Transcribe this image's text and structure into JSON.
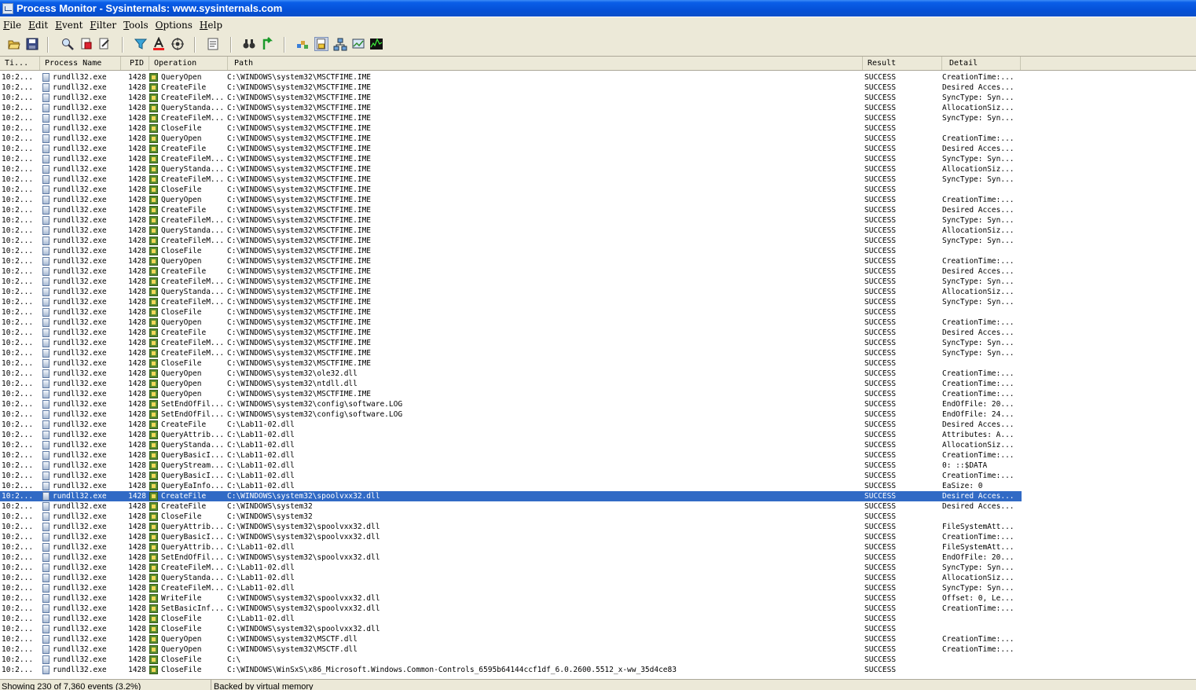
{
  "window": {
    "title": "Process Monitor - Sysinternals: www.sysinternals.com"
  },
  "menu": [
    "File",
    "Edit",
    "Event",
    "Filter",
    "Tools",
    "Options",
    "Help"
  ],
  "toolbar": [
    "open-icon",
    "save-icon",
    "magnify-icon",
    "capture-icon",
    "clear-icon",
    "filter-icon",
    "highlight-icon",
    "target-icon",
    "properties-icon",
    "find-icon",
    "jump-icon",
    "registry-icon",
    "filesystem-icon",
    "network-icon",
    "process-icon",
    "profiling-icon"
  ],
  "columns": {
    "time": "Ti...",
    "process": "Process Name",
    "pid": "PID",
    "operation": "Operation",
    "path": "Path",
    "result": "Result",
    "detail": "Detail"
  },
  "rows": [
    [
      "10:2...",
      "rundll32.exe",
      "1428",
      "QueryOpen",
      "C:\\WINDOWS\\system32\\MSCTFIME.IME",
      "SUCCESS",
      "CreationTime:..."
    ],
    [
      "10:2...",
      "rundll32.exe",
      "1428",
      "CreateFile",
      "C:\\WINDOWS\\system32\\MSCTFIME.IME",
      "SUCCESS",
      "Desired Acces..."
    ],
    [
      "10:2...",
      "rundll32.exe",
      "1428",
      "CreateFileM...",
      "C:\\WINDOWS\\system32\\MSCTFIME.IME",
      "SUCCESS",
      "SyncType: Syn..."
    ],
    [
      "10:2...",
      "rundll32.exe",
      "1428",
      "QueryStanda...",
      "C:\\WINDOWS\\system32\\MSCTFIME.IME",
      "SUCCESS",
      "AllocationSiz..."
    ],
    [
      "10:2...",
      "rundll32.exe",
      "1428",
      "CreateFileM...",
      "C:\\WINDOWS\\system32\\MSCTFIME.IME",
      "SUCCESS",
      "SyncType: Syn..."
    ],
    [
      "10:2...",
      "rundll32.exe",
      "1428",
      "CloseFile",
      "C:\\WINDOWS\\system32\\MSCTFIME.IME",
      "SUCCESS",
      ""
    ],
    [
      "10:2...",
      "rundll32.exe",
      "1428",
      "QueryOpen",
      "C:\\WINDOWS\\system32\\MSCTFIME.IME",
      "SUCCESS",
      "CreationTime:..."
    ],
    [
      "10:2...",
      "rundll32.exe",
      "1428",
      "CreateFile",
      "C:\\WINDOWS\\system32\\MSCTFIME.IME",
      "SUCCESS",
      "Desired Acces..."
    ],
    [
      "10:2...",
      "rundll32.exe",
      "1428",
      "CreateFileM...",
      "C:\\WINDOWS\\system32\\MSCTFIME.IME",
      "SUCCESS",
      "SyncType: Syn..."
    ],
    [
      "10:2...",
      "rundll32.exe",
      "1428",
      "QueryStanda...",
      "C:\\WINDOWS\\system32\\MSCTFIME.IME",
      "SUCCESS",
      "AllocationSiz..."
    ],
    [
      "10:2...",
      "rundll32.exe",
      "1428",
      "CreateFileM...",
      "C:\\WINDOWS\\system32\\MSCTFIME.IME",
      "SUCCESS",
      "SyncType: Syn..."
    ],
    [
      "10:2...",
      "rundll32.exe",
      "1428",
      "CloseFile",
      "C:\\WINDOWS\\system32\\MSCTFIME.IME",
      "SUCCESS",
      ""
    ],
    [
      "10:2...",
      "rundll32.exe",
      "1428",
      "QueryOpen",
      "C:\\WINDOWS\\system32\\MSCTFIME.IME",
      "SUCCESS",
      "CreationTime:..."
    ],
    [
      "10:2...",
      "rundll32.exe",
      "1428",
      "CreateFile",
      "C:\\WINDOWS\\system32\\MSCTFIME.IME",
      "SUCCESS",
      "Desired Acces..."
    ],
    [
      "10:2...",
      "rundll32.exe",
      "1428",
      "CreateFileM...",
      "C:\\WINDOWS\\system32\\MSCTFIME.IME",
      "SUCCESS",
      "SyncType: Syn..."
    ],
    [
      "10:2...",
      "rundll32.exe",
      "1428",
      "QueryStanda...",
      "C:\\WINDOWS\\system32\\MSCTFIME.IME",
      "SUCCESS",
      "AllocationSiz..."
    ],
    [
      "10:2...",
      "rundll32.exe",
      "1428",
      "CreateFileM...",
      "C:\\WINDOWS\\system32\\MSCTFIME.IME",
      "SUCCESS",
      "SyncType: Syn..."
    ],
    [
      "10:2...",
      "rundll32.exe",
      "1428",
      "CloseFile",
      "C:\\WINDOWS\\system32\\MSCTFIME.IME",
      "SUCCESS",
      ""
    ],
    [
      "10:2...",
      "rundll32.exe",
      "1428",
      "QueryOpen",
      "C:\\WINDOWS\\system32\\MSCTFIME.IME",
      "SUCCESS",
      "CreationTime:..."
    ],
    [
      "10:2...",
      "rundll32.exe",
      "1428",
      "CreateFile",
      "C:\\WINDOWS\\system32\\MSCTFIME.IME",
      "SUCCESS",
      "Desired Acces..."
    ],
    [
      "10:2...",
      "rundll32.exe",
      "1428",
      "CreateFileM...",
      "C:\\WINDOWS\\system32\\MSCTFIME.IME",
      "SUCCESS",
      "SyncType: Syn..."
    ],
    [
      "10:2...",
      "rundll32.exe",
      "1428",
      "QueryStanda...",
      "C:\\WINDOWS\\system32\\MSCTFIME.IME",
      "SUCCESS",
      "AllocationSiz..."
    ],
    [
      "10:2...",
      "rundll32.exe",
      "1428",
      "CreateFileM...",
      "C:\\WINDOWS\\system32\\MSCTFIME.IME",
      "SUCCESS",
      "SyncType: Syn..."
    ],
    [
      "10:2...",
      "rundll32.exe",
      "1428",
      "CloseFile",
      "C:\\WINDOWS\\system32\\MSCTFIME.IME",
      "SUCCESS",
      ""
    ],
    [
      "10:2...",
      "rundll32.exe",
      "1428",
      "QueryOpen",
      "C:\\WINDOWS\\system32\\MSCTFIME.IME",
      "SUCCESS",
      "CreationTime:..."
    ],
    [
      "10:2...",
      "rundll32.exe",
      "1428",
      "CreateFile",
      "C:\\WINDOWS\\system32\\MSCTFIME.IME",
      "SUCCESS",
      "Desired Acces..."
    ],
    [
      "10:2...",
      "rundll32.exe",
      "1428",
      "CreateFileM...",
      "C:\\WINDOWS\\system32\\MSCTFIME.IME",
      "SUCCESS",
      "SyncType: Syn..."
    ],
    [
      "10:2...",
      "rundll32.exe",
      "1428",
      "CreateFileM...",
      "C:\\WINDOWS\\system32\\MSCTFIME.IME",
      "SUCCESS",
      "SyncType: Syn..."
    ],
    [
      "10:2...",
      "rundll32.exe",
      "1428",
      "CloseFile",
      "C:\\WINDOWS\\system32\\MSCTFIME.IME",
      "SUCCESS",
      ""
    ],
    [
      "10:2...",
      "rundll32.exe",
      "1428",
      "QueryOpen",
      "C:\\WINDOWS\\system32\\ole32.dll",
      "SUCCESS",
      "CreationTime:..."
    ],
    [
      "10:2...",
      "rundll32.exe",
      "1428",
      "QueryOpen",
      "C:\\WINDOWS\\system32\\ntdll.dll",
      "SUCCESS",
      "CreationTime:..."
    ],
    [
      "10:2...",
      "rundll32.exe",
      "1428",
      "QueryOpen",
      "C:\\WINDOWS\\system32\\MSCTFIME.IME",
      "SUCCESS",
      "CreationTime:..."
    ],
    [
      "10:2...",
      "rundll32.exe",
      "1428",
      "SetEndOfFil...",
      "C:\\WINDOWS\\system32\\config\\software.LOG",
      "SUCCESS",
      "EndOfFile: 20..."
    ],
    [
      "10:2...",
      "rundll32.exe",
      "1428",
      "SetEndOfFil...",
      "C:\\WINDOWS\\system32\\config\\software.LOG",
      "SUCCESS",
      "EndOfFile: 24..."
    ],
    [
      "10:2...",
      "rundll32.exe",
      "1428",
      "CreateFile",
      "C:\\Lab11-02.dll",
      "SUCCESS",
      "Desired Acces..."
    ],
    [
      "10:2...",
      "rundll32.exe",
      "1428",
      "QueryAttrib...",
      "C:\\Lab11-02.dll",
      "SUCCESS",
      "Attributes: A..."
    ],
    [
      "10:2...",
      "rundll32.exe",
      "1428",
      "QueryStanda...",
      "C:\\Lab11-02.dll",
      "SUCCESS",
      "AllocationSiz..."
    ],
    [
      "10:2...",
      "rundll32.exe",
      "1428",
      "QueryBasicI...",
      "C:\\Lab11-02.dll",
      "SUCCESS",
      "CreationTime:..."
    ],
    [
      "10:2...",
      "rundll32.exe",
      "1428",
      "QueryStream...",
      "C:\\Lab11-02.dll",
      "SUCCESS",
      "0: ::$DATA"
    ],
    [
      "10:2...",
      "rundll32.exe",
      "1428",
      "QueryBasicI...",
      "C:\\Lab11-02.dll",
      "SUCCESS",
      "CreationTime:..."
    ],
    [
      "10:2...",
      "rundll32.exe",
      "1428",
      "QueryEaInfo...",
      "C:\\Lab11-02.dll",
      "SUCCESS",
      "EaSize: 0"
    ],
    [
      "10:2...",
      "rundll32.exe",
      "1428",
      "CreateFile",
      "C:\\WINDOWS\\system32\\spoolvxx32.dll",
      "SUCCESS",
      "Desired Acces..."
    ],
    [
      "10:2...",
      "rundll32.exe",
      "1428",
      "CreateFile",
      "C:\\WINDOWS\\system32",
      "SUCCESS",
      "Desired Acces..."
    ],
    [
      "10:2...",
      "rundll32.exe",
      "1428",
      "CloseFile",
      "C:\\WINDOWS\\system32",
      "SUCCESS",
      ""
    ],
    [
      "10:2...",
      "rundll32.exe",
      "1428",
      "QueryAttrib...",
      "C:\\WINDOWS\\system32\\spoolvxx32.dll",
      "SUCCESS",
      "FileSystemAtt..."
    ],
    [
      "10:2...",
      "rundll32.exe",
      "1428",
      "QueryBasicI...",
      "C:\\WINDOWS\\system32\\spoolvxx32.dll",
      "SUCCESS",
      "CreationTime:..."
    ],
    [
      "10:2...",
      "rundll32.exe",
      "1428",
      "QueryAttrib...",
      "C:\\Lab11-02.dll",
      "SUCCESS",
      "FileSystemAtt..."
    ],
    [
      "10:2...",
      "rundll32.exe",
      "1428",
      "SetEndOfFil...",
      "C:\\WINDOWS\\system32\\spoolvxx32.dll",
      "SUCCESS",
      "EndOfFile: 20..."
    ],
    [
      "10:2...",
      "rundll32.exe",
      "1428",
      "CreateFileM...",
      "C:\\Lab11-02.dll",
      "SUCCESS",
      "SyncType: Syn..."
    ],
    [
      "10:2...",
      "rundll32.exe",
      "1428",
      "QueryStanda...",
      "C:\\Lab11-02.dll",
      "SUCCESS",
      "AllocationSiz..."
    ],
    [
      "10:2...",
      "rundll32.exe",
      "1428",
      "CreateFileM...",
      "C:\\Lab11-02.dll",
      "SUCCESS",
      "SyncType: Syn..."
    ],
    [
      "10:2...",
      "rundll32.exe",
      "1428",
      "WriteFile",
      "C:\\WINDOWS\\system32\\spoolvxx32.dll",
      "SUCCESS",
      "Offset: 0, Le..."
    ],
    [
      "10:2...",
      "rundll32.exe",
      "1428",
      "SetBasicInf...",
      "C:\\WINDOWS\\system32\\spoolvxx32.dll",
      "SUCCESS",
      "CreationTime:..."
    ],
    [
      "10:2...",
      "rundll32.exe",
      "1428",
      "CloseFile",
      "C:\\Lab11-02.dll",
      "SUCCESS",
      ""
    ],
    [
      "10:2...",
      "rundll32.exe",
      "1428",
      "CloseFile",
      "C:\\WINDOWS\\system32\\spoolvxx32.dll",
      "SUCCESS",
      ""
    ],
    [
      "10:2...",
      "rundll32.exe",
      "1428",
      "QueryOpen",
      "C:\\WINDOWS\\system32\\MSCTF.dll",
      "SUCCESS",
      "CreationTime:..."
    ],
    [
      "10:2...",
      "rundll32.exe",
      "1428",
      "QueryOpen",
      "C:\\WINDOWS\\system32\\MSCTF.dll",
      "SUCCESS",
      "CreationTime:..."
    ],
    [
      "10:2...",
      "rundll32.exe",
      "1428",
      "CloseFile",
      "C:\\",
      "SUCCESS",
      ""
    ],
    [
      "10:2...",
      "rundll32.exe",
      "1428",
      "CloseFile",
      "C:\\WINDOWS\\WinSxS\\x86_Microsoft.Windows.Common-Controls_6595b64144ccf1df_6.0.2600.5512_x-ww_35d4ce83",
      "SUCCESS",
      ""
    ]
  ],
  "selected_row": 41,
  "status": {
    "events": "Showing 230 of 7,360 events (3.2%)",
    "memory": "Backed by virtual memory"
  },
  "colors": {
    "selection": "#316ac5",
    "titlebar": "#0a5ee8",
    "chrome": "#ece9d8"
  }
}
